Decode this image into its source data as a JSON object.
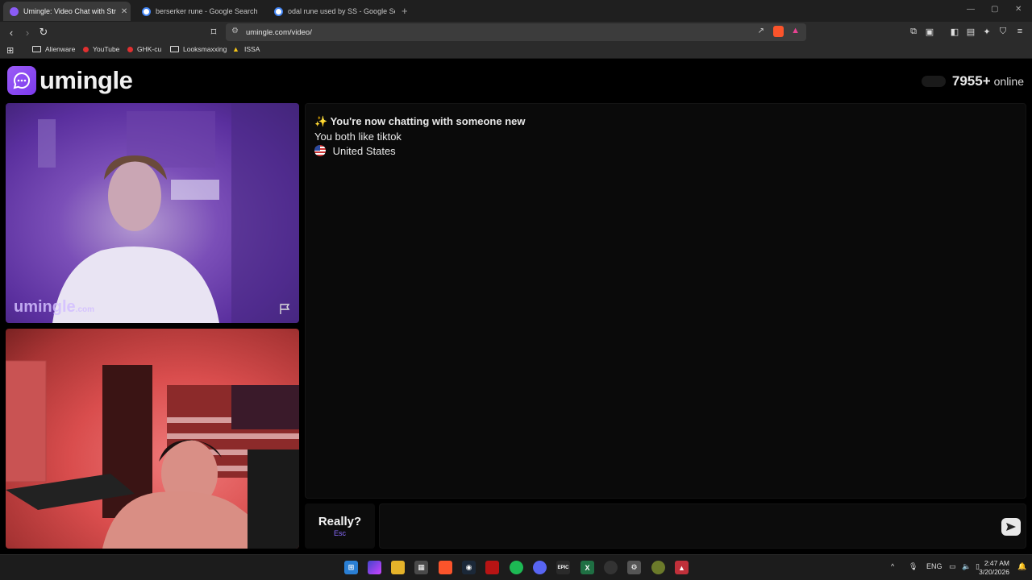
{
  "browser": {
    "tabs": [
      {
        "title": "Umingle: Video Chat with Str",
        "active": true
      },
      {
        "title": "berserker rune - Google Search",
        "active": false
      },
      {
        "title": "odal rune used by SS - Google Search",
        "active": false
      }
    ],
    "new_tab": "+",
    "url": "umingle.com/video/",
    "bookmarks": [
      "Alienware",
      "YouTube",
      "GHK-cu",
      "Looksmaxxing",
      "ISSA"
    ]
  },
  "site": {
    "logo_text": "umingle",
    "online_count": "7955+",
    "online_label": "online",
    "accent_color": "#8b5cf6"
  },
  "video": {
    "watermark": "umingle",
    "watermark_suffix": ".com"
  },
  "chat": {
    "messages": [
      {
        "icon": "✨",
        "text": "You're now chatting with someone new"
      },
      {
        "text": "You both like tiktok"
      },
      {
        "text": "United States"
      }
    ],
    "really_label": "Really?",
    "really_hint": "Esc",
    "input_placeholder": ""
  },
  "taskbar": {
    "language": "ENG",
    "time": "2:47 AM",
    "date": "3/20/2026"
  }
}
